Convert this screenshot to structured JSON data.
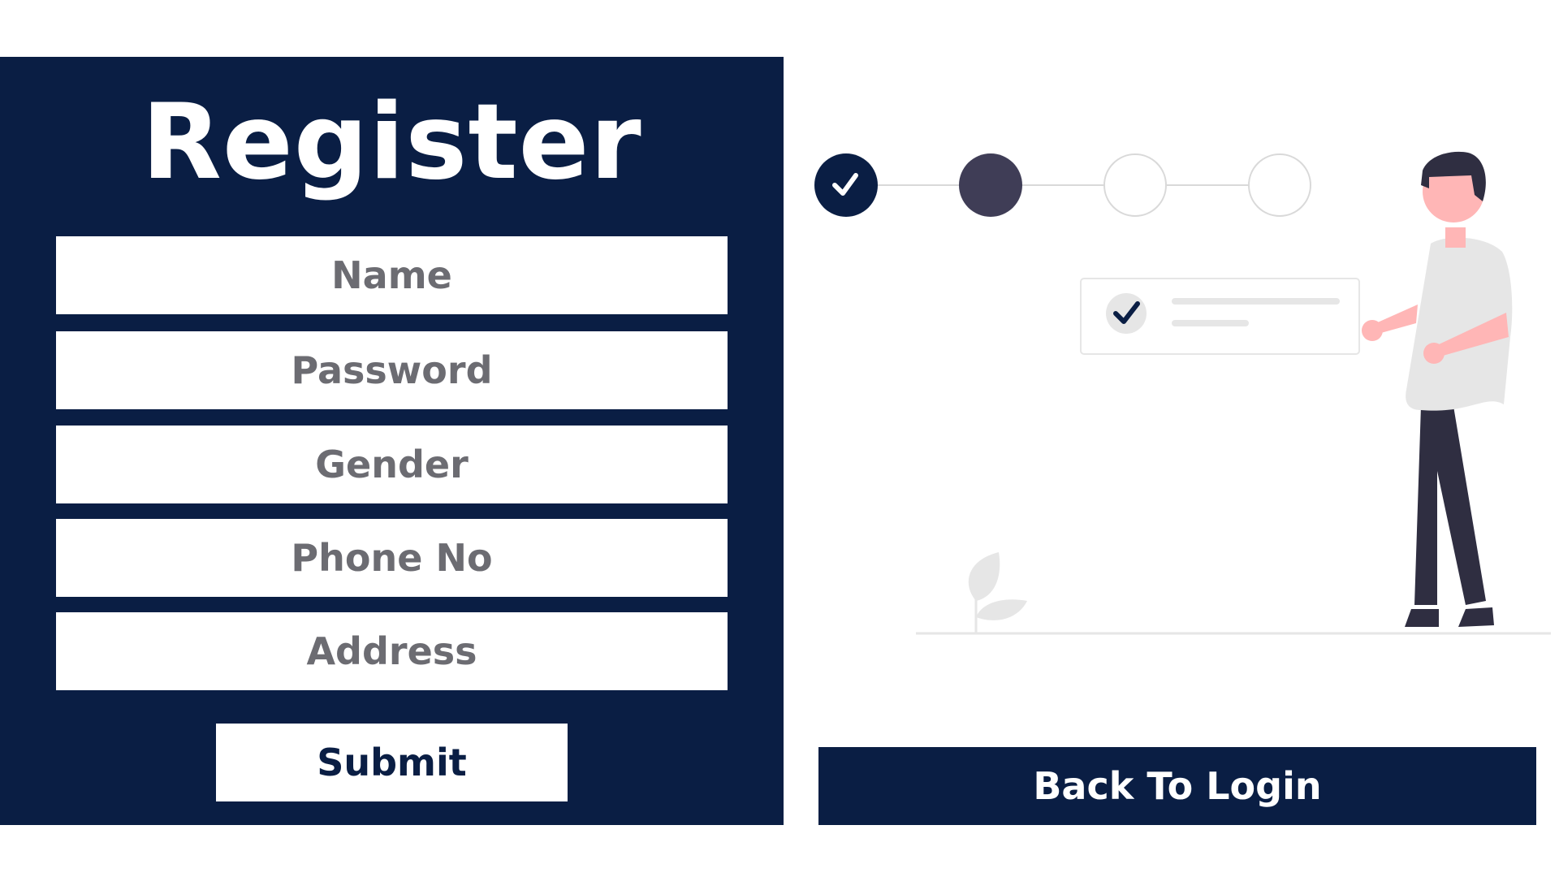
{
  "form": {
    "title": "Register",
    "fields": [
      {
        "placeholder": "Name"
      },
      {
        "placeholder": "Password"
      },
      {
        "placeholder": "Gender"
      },
      {
        "placeholder": "Phone No"
      },
      {
        "placeholder": "Address"
      }
    ],
    "submit_label": "Submit"
  },
  "actions": {
    "back_label": "Back To Login"
  },
  "progress": {
    "total_steps": 4,
    "completed_steps": 1,
    "current_step": 2
  },
  "colors": {
    "navy": "#0a1e44",
    "dark_step": "#3f3d56",
    "field_text": "#6c6c72",
    "skin": "#ffb6b6",
    "light_gray": "#e6e6e6"
  },
  "icons": {
    "step_check": "check-icon",
    "card_check": "check-circle-icon",
    "illustration": "person-illustration"
  }
}
